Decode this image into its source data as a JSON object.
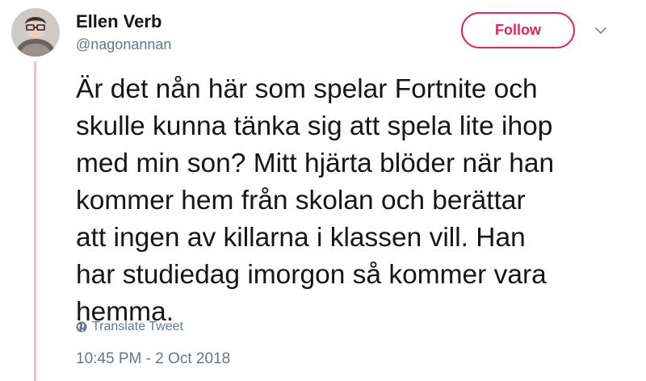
{
  "author": {
    "name": "Ellen Verb",
    "handle": "@nagonannan"
  },
  "actions": {
    "follow_label": "Follow",
    "more_icon": "chevron-down-icon"
  },
  "tweet": {
    "text": "Är det nån här som spelar Fortnite och\nskulle kunna tänka sig att spela lite ihop\nmed min son? Mitt hjärta blöder när han\nkommer hem från skolan och berättar\natt ingen av killarna i klassen vill. Han\nhar studiedag imorgon så kommer vara\nhemma.",
    "translate_label": "Translate Tweet",
    "translate_icon": "globe-icon",
    "timestamp": "10:45 PM - 2 Oct 2018"
  },
  "colors": {
    "accent": "#e0245e",
    "thread_line": "#ecc3cd",
    "secondary_text": "#657786",
    "primary_text": "#14171a"
  }
}
